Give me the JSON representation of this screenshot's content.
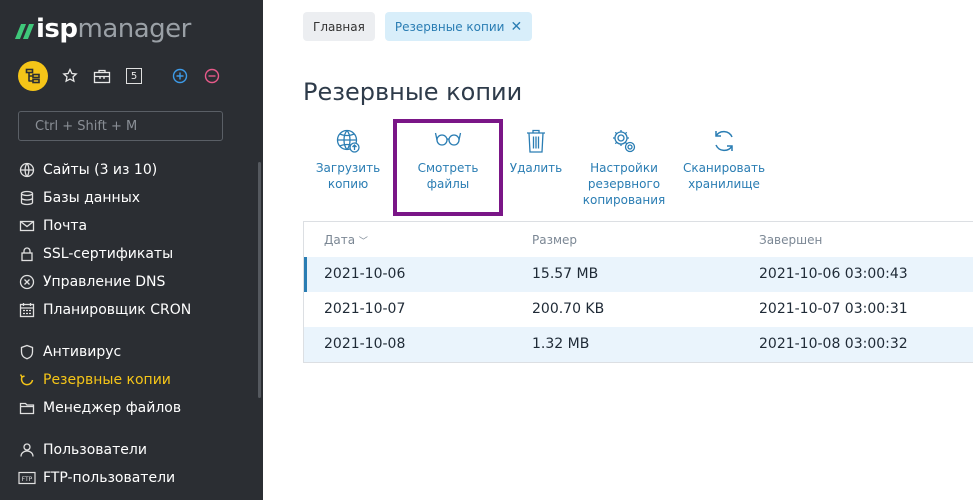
{
  "app": {
    "logo_part1": "isp",
    "logo_part2": "manager",
    "counter_badge": "5"
  },
  "search": {
    "placeholder": "Ctrl + Shift + M"
  },
  "sidebar": {
    "items": [
      {
        "label": "Сайты (3 из 10)",
        "icon": "globe-icon"
      },
      {
        "label": "Базы данных",
        "icon": "database-icon"
      },
      {
        "label": "Почта",
        "icon": "mail-icon"
      },
      {
        "label": "SSL-сертификаты",
        "icon": "lock-icon"
      },
      {
        "label": "Управление DNS",
        "icon": "dns-icon"
      },
      {
        "label": "Планировщик CRON",
        "icon": "calendar-icon"
      },
      {
        "label": "Антивирус",
        "icon": "shield-icon"
      },
      {
        "label": "Резервные копии",
        "icon": "backup-icon",
        "active": true
      },
      {
        "label": "Менеджер файлов",
        "icon": "folder-icon"
      },
      {
        "label": "Пользователи",
        "icon": "user-icon"
      },
      {
        "label": "FTP-пользователи",
        "icon": "ftp-icon"
      }
    ]
  },
  "breadcrumbs": [
    "Главная",
    "Резервные копии"
  ],
  "page": {
    "title": "Резервные копии"
  },
  "actions": [
    {
      "label": "Загрузить копию",
      "line1": "Загрузить",
      "line2": "копию",
      "line3": "",
      "icon": "upload-globe-icon"
    },
    {
      "label": "Смотреть файлы",
      "line1": "Смотреть",
      "line2": "файлы",
      "line3": "",
      "icon": "glasses-icon"
    },
    {
      "label": "Удалить",
      "line1": "Удалить",
      "line2": "",
      "line3": "",
      "icon": "trash-icon"
    },
    {
      "label": "Настройки резервного копирования",
      "line1": "Настройки",
      "line2": "резервного",
      "line3": "копирования",
      "icon": "settings-icon"
    },
    {
      "label": "Сканировать хранилище",
      "line1": "Сканировать",
      "line2": "хранилище",
      "line3": "",
      "icon": "refresh-icon"
    }
  ],
  "table": {
    "columns": [
      "Дата",
      "Размер",
      "Завершен"
    ],
    "rows": [
      {
        "date": "2021-10-06",
        "size": "15.57 MB",
        "finished": "2021-10-06 03:00:43"
      },
      {
        "date": "2021-10-07",
        "size": "200.70 KB",
        "finished": "2021-10-07 03:00:31"
      },
      {
        "date": "2021-10-08",
        "size": "1.32 MB",
        "finished": "2021-10-08 03:00:32"
      }
    ]
  },
  "colors": {
    "sidebar_bg": "#2b2e33",
    "accent_yellow": "#f5c518",
    "link_blue": "#2a7db3",
    "highlight_purple": "#7a1687",
    "logo_green": "#3fc87a"
  }
}
